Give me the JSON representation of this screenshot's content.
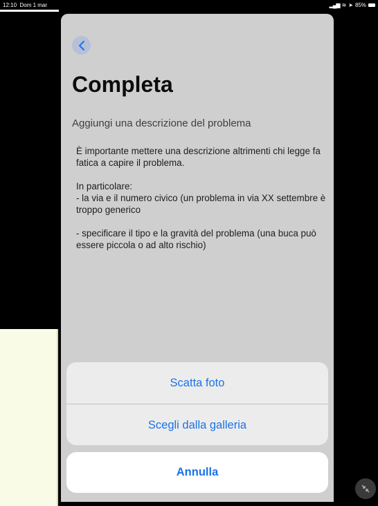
{
  "status_bar": {
    "time": "12:10",
    "date": "Dom 1 mar",
    "battery": "85%",
    "icons": [
      "signal-icon",
      "wifi-icon",
      "location-icon",
      "battery-icon"
    ]
  },
  "page": {
    "title": "Completa",
    "field_label": "Aggiungi una descrizione del problema",
    "description": "È importante mettere una descrizione altrimenti chi legge fa fatica a capire il problema.\n\nIn particolare:\n- la via e il numero civico (un problema in via XX settembre è troppo generico\n\n- specificare il tipo e la gravità del problema (una buca può essere piccola o ad alto rischio)"
  },
  "action_sheet": {
    "take_photo": "Scatta foto",
    "choose_gallery": "Scegli dalla galleria",
    "cancel": "Annulla"
  },
  "colors": {
    "accent": "#1a73e8",
    "sheet_background": "#cfcfcf",
    "back_button": "#b6c1d7"
  }
}
